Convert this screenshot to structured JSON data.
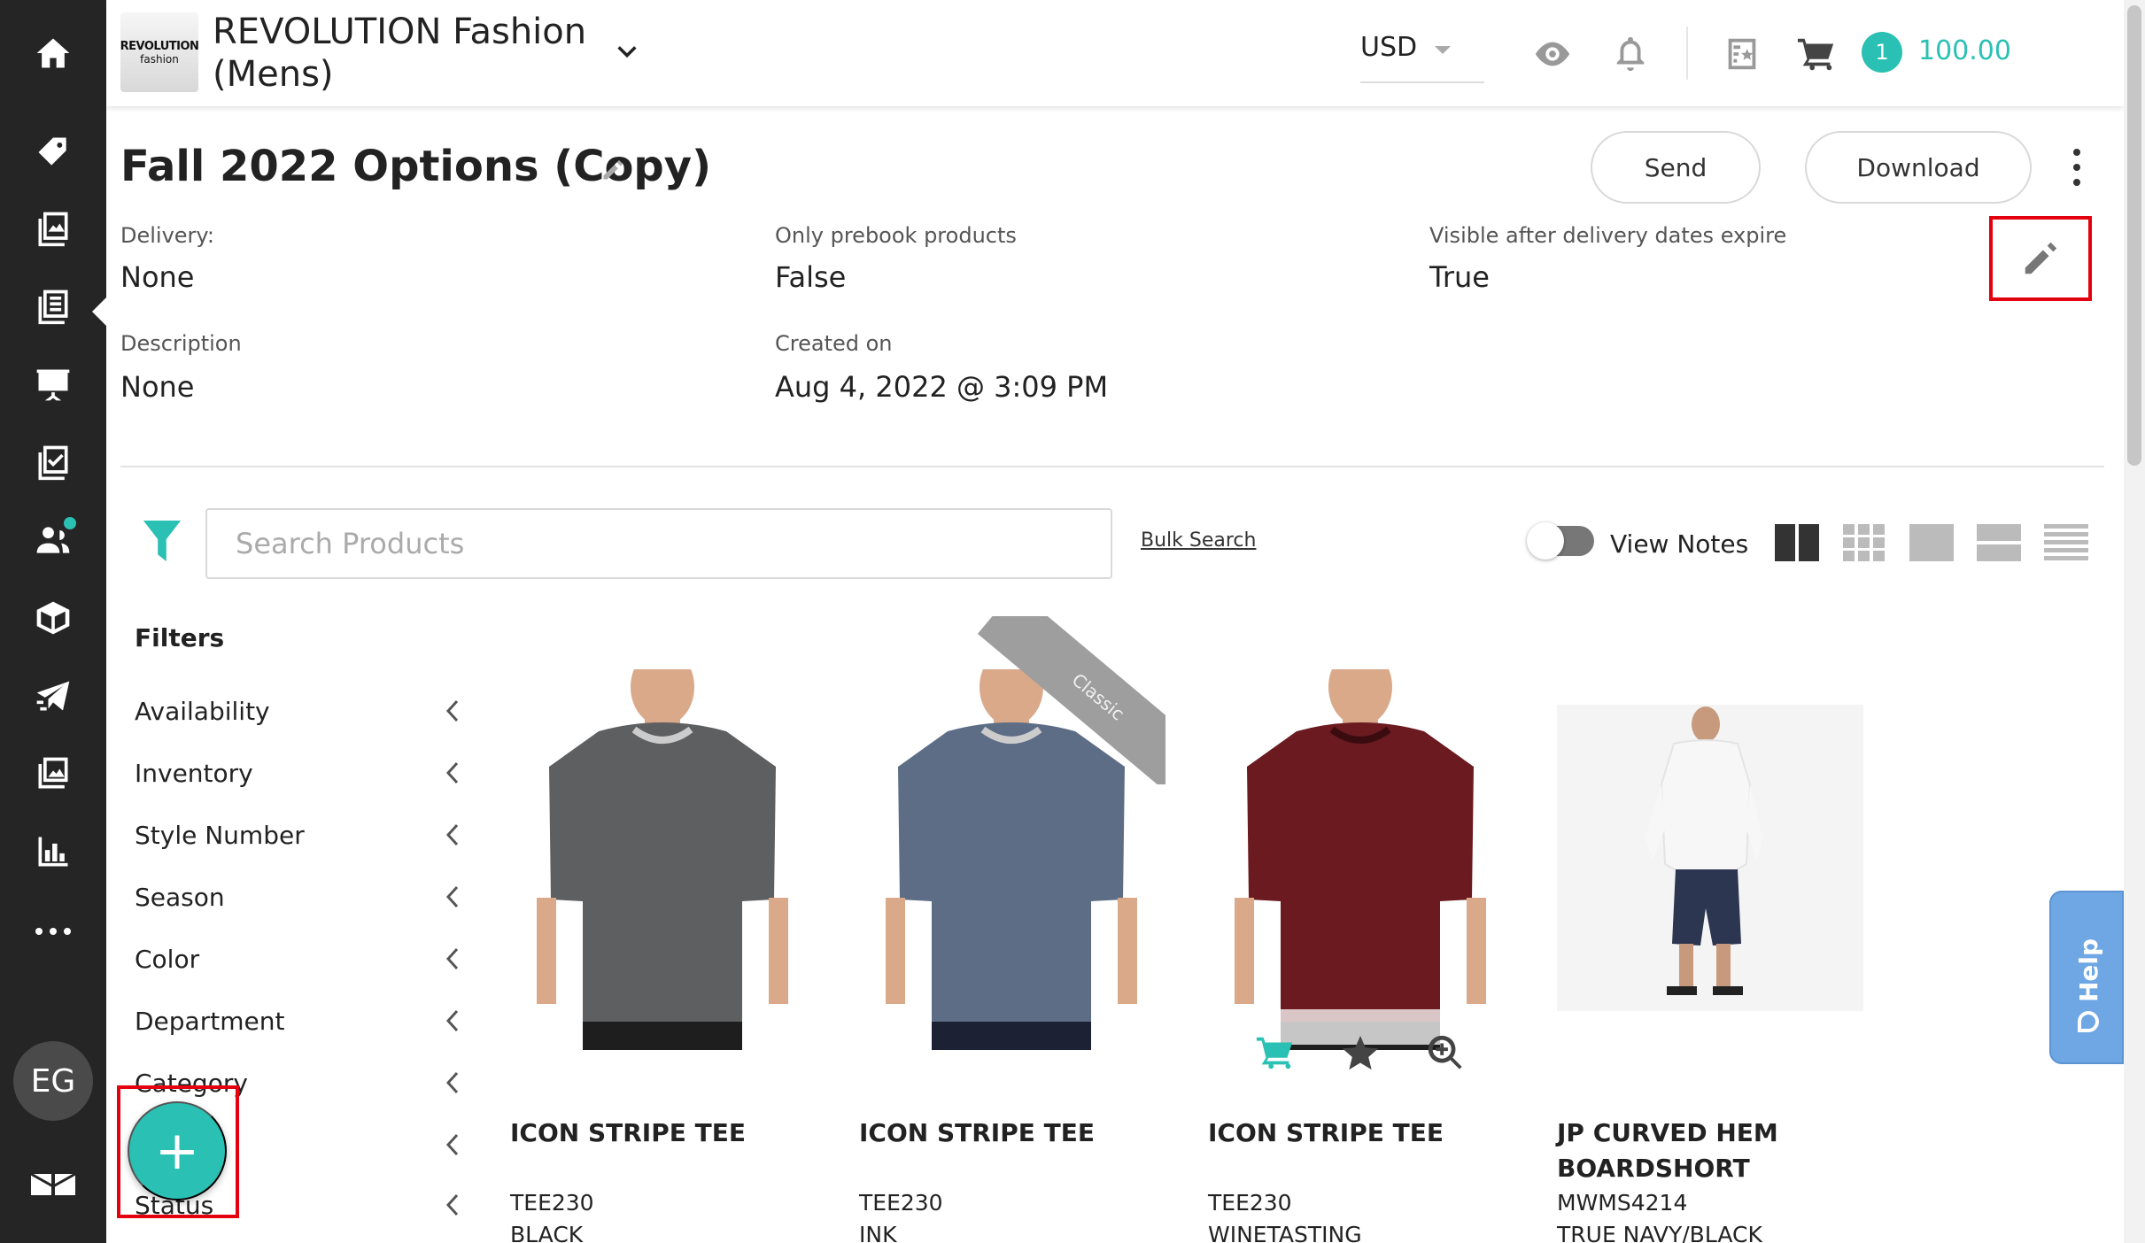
{
  "brand": {
    "logo_line1": "REVOLUTION",
    "logo_line2": "fashion",
    "name": "REVOLUTION Fashion (Mens)"
  },
  "topbar": {
    "currency": "USD",
    "cart_count": "1",
    "cart_total": "100.00"
  },
  "page": {
    "title": "Fall 2022 Options (Copy)",
    "send_label": "Send",
    "download_label": "Download"
  },
  "meta": {
    "delivery_label": "Delivery:",
    "delivery_value": "None",
    "prebook_label": "Only prebook products",
    "prebook_value": "False",
    "visible_label": "Visible after delivery dates expire",
    "visible_value": "True",
    "description_label": "Description",
    "description_value": "None",
    "created_label": "Created on",
    "created_value": "Aug 4, 2022 @ 3:09 PM"
  },
  "search": {
    "placeholder": "Search Products",
    "bulk_label": "Bulk Search",
    "view_notes_label": "View Notes"
  },
  "filters": {
    "heading": "Filters",
    "items": [
      "Availability",
      "Inventory",
      "Style Number",
      "Season",
      "Color",
      "Department",
      "Category",
      "",
      "Status"
    ]
  },
  "products": [
    {
      "name": "ICON STRIPE TEE",
      "style": "TEE230",
      "color": "BLACK",
      "shirt_color": "#5e5f60"
    },
    {
      "name": "ICON STRIPE TEE",
      "style": "TEE230",
      "color": "INK",
      "shirt_color": "#5d6d86",
      "ribbon": "Classic"
    },
    {
      "name": "ICON STRIPE TEE",
      "style": "TEE230",
      "color": "WINETASTING",
      "shirt_color": "#6b1a20"
    },
    {
      "name": "JP CURVED HEM BOARDSHORT",
      "style": "MWMS4214",
      "color": "TRUE NAVY/BLACK"
    }
  ],
  "avatar": {
    "initials": "EG"
  },
  "help": {
    "label": "Help"
  },
  "fab": {
    "label": "+"
  },
  "colors": {
    "accent": "#2bc0b4",
    "sidebar": "#252525",
    "highlight": "#e3000f",
    "help": "#6ea7e4"
  }
}
